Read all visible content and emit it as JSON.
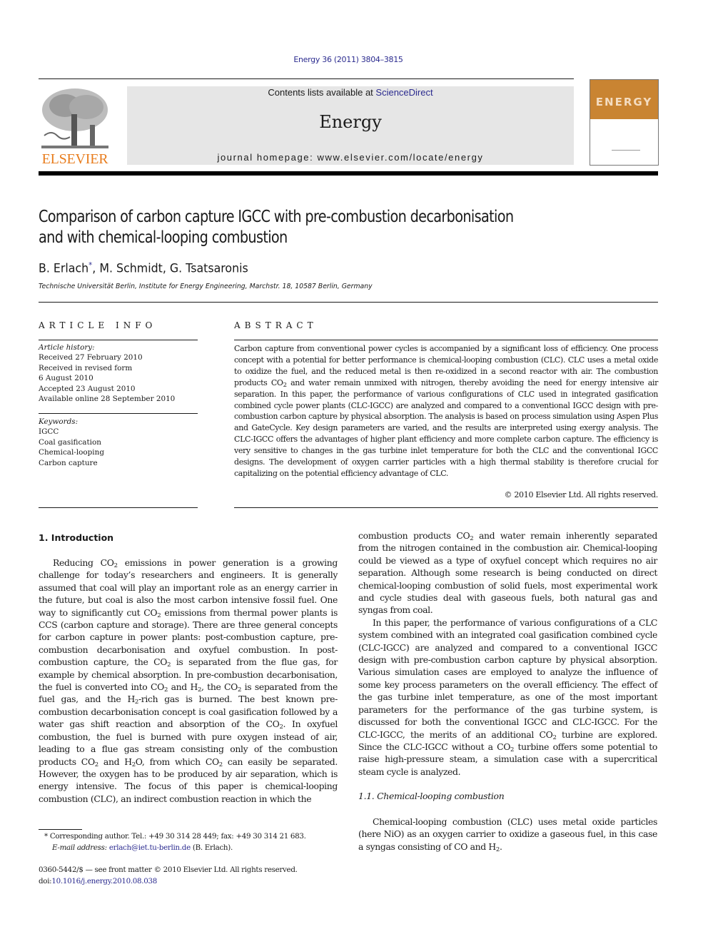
{
  "header": {
    "citation": "Energy 36 (2011) 3804–3815",
    "contents_prefix": "Contents lists available at ",
    "contents_link": "ScienceDirect",
    "journal_name": "Energy",
    "homepage": "journal homepage: www.elsevier.com/locate/energy",
    "publisher_wordmark": "ELSEVIER",
    "cover_title": "ENERGY",
    "colors": {
      "link": "#2b2b8f",
      "elsevier_orange": "#e87d1e",
      "cover_orange": "#c98432",
      "banner_gray": "#e6e6e6"
    }
  },
  "article": {
    "title_line1": "Comparison of carbon capture IGCC with pre-combustion decarbonisation",
    "title_line2": "and with chemical-looping combustion",
    "authors": [
      {
        "name": "B. Erlach",
        "mark": "*"
      },
      {
        "name": ", M. Schmidt, G. Tsatsaronis",
        "mark": ""
      }
    ],
    "affiliation": "Technische Universität Berlin, Institute for Energy Engineering, Marchstr. 18, 10587 Berlin, Germany"
  },
  "article_info": {
    "heading": "ARTICLE INFO",
    "history_label": "Article history:",
    "history": [
      "Received 27 February 2010",
      "Received in revised form",
      "6 August 2010",
      "Accepted 23 August 2010",
      "Available online 28 September 2010"
    ],
    "keywords_label": "Keywords:",
    "keywords": [
      "IGCC",
      "Coal gasification",
      "Chemical-looping",
      "Carbon capture"
    ]
  },
  "abstract": {
    "heading": "ABSTRACT",
    "segments": [
      [
        "t",
        "Carbon capture from conventional power cycles is accompanied by a significant loss of efficiency. One process concept with a potential for better performance is chemical-looping combustion (CLC). CLC uses a metal oxide to oxidize the fuel, and the reduced metal is then re-oxidized in a second reactor with air. The combustion products CO"
      ],
      [
        "s",
        "2"
      ],
      [
        "t",
        " and water remain unmixed with nitrogen, thereby avoiding the need for energy intensive air separation. In this paper, the performance of various configurations of CLC used in integrated gasification combined cycle power plants (CLC-IGCC) are analyzed and compared to a conventional IGCC design with pre-combustion carbon capture by physical absorption. The analysis is based on process simulation using Aspen Plus and GateCycle. Key design parameters are varied, and the results are interpreted using exergy analysis. The CLC-IGCC offers the advantages of higher plant efficiency and more complete carbon capture. The efficiency is very sensitive to changes in the gas turbine inlet temperature for both the CLC and the conventional IGCC designs. The development of oxygen carrier particles with a high thermal stability is therefore crucial for capitalizing on the potential efficiency advantage of CLC."
      ]
    ],
    "copyright": "© 2010 Elsevier Ltd. All rights reserved."
  },
  "body": {
    "section1_heading": "1.  Introduction",
    "left_paragraph": [
      [
        "t",
        "Reducing CO"
      ],
      [
        "s",
        "2"
      ],
      [
        "t",
        " emissions in power generation is a growing challenge for today’s researchers and engineers. It is generally assumed that coal will play an important role as an energy carrier in the future, but coal is also the most carbon intensive fossil fuel. One way to significantly cut CO"
      ],
      [
        "s",
        "2"
      ],
      [
        "t",
        " emissions from thermal power plants is CCS (carbon capture and storage). There are three general concepts for carbon capture in power plants: post-combustion capture, pre-combustion decarbonisation and oxyfuel combustion. In post-combustion capture, the CO"
      ],
      [
        "s",
        "2"
      ],
      [
        "t",
        " is separated from the flue gas, for example by chemical absorption. In pre-combustion decarbonisation, the fuel is converted into CO"
      ],
      [
        "s",
        "2"
      ],
      [
        "t",
        " and H"
      ],
      [
        "s",
        "2"
      ],
      [
        "t",
        ", the CO"
      ],
      [
        "s",
        "2"
      ],
      [
        "t",
        " is separated from the fuel gas, and the H"
      ],
      [
        "s",
        "2"
      ],
      [
        "t",
        "-rich gas is burned. The best known pre-combustion decarbonisation concept is coal gasification followed by a water gas shift reaction and absorption of the CO"
      ],
      [
        "s",
        "2"
      ],
      [
        "t",
        ". In oxyfuel combustion, the fuel is burned with pure oxygen instead of air, leading to a flue gas stream consisting only of the combustion products CO"
      ],
      [
        "s",
        "2"
      ],
      [
        "t",
        " and H"
      ],
      [
        "s",
        "2"
      ],
      [
        "t",
        "O, from which CO"
      ],
      [
        "s",
        "2"
      ],
      [
        "t",
        " can easily be separated. However, the oxygen has to be produced by air separation, which is energy intensive. The focus of this paper is chemical-looping combustion (CLC), an indirect combustion reaction in which the"
      ]
    ],
    "right_paragraph1": [
      [
        "t",
        "combustion products CO"
      ],
      [
        "s",
        "2"
      ],
      [
        "t",
        " and water remain inherently separated from the nitrogen contained in the combustion air. Chemical-looping could be viewed as a type of oxyfuel concept which requires no air separation. Although some research is being conducted on direct chemical-looping combustion of solid fuels, most experimental work and cycle studies deal with gaseous fuels, both natural gas and syngas from coal."
      ]
    ],
    "right_paragraph2": [
      [
        "t",
        "In this paper, the performance of various configurations of a CLC system combined  with an integrated coal gasification combined cycle (CLC-IGCC) are analyzed and compared to a conventional IGCC design with pre-combustion carbon capture by physical absorption. Various simulation cases are employed to analyze the influence of some key process parameters on the overall efficiency. The effect of the gas turbine inlet temperature, as one of the most important parameters for the performance of the gas turbine system, is discussed for both the conventional IGCC and CLC-IGCC. For the CLC-IGCC, the merits of an additional CO"
      ],
      [
        "s",
        "2"
      ],
      [
        "t",
        " turbine are explored. Since the CLC-IGCC without a CO"
      ],
      [
        "s",
        "2"
      ],
      [
        "t",
        " turbine offers some potential to raise high-pressure steam, a simulation case with a supercritical steam cycle is analyzed."
      ]
    ],
    "subsection_heading": "1.1.  Chemical-looping combustion",
    "right_paragraph3": [
      [
        "t",
        "Chemical-looping combustion (CLC) uses metal oxide particles (here NiO) as an oxygen carrier to oxidize a gaseous fuel, in this case a syngas consisting of CO and H"
      ],
      [
        "s",
        "2"
      ],
      [
        "t",
        "."
      ]
    ]
  },
  "footnotes": {
    "corresponding": "*  Corresponding author. Tel.: +49 30 314 28 449; fax: +49 30 314 21 683.",
    "email_label": "E-mail address:",
    "email": "erlach@iet.tu-berlin.de",
    "email_suffix": " (B. Erlach).",
    "front_matter": "0360-5442/$ — see front matter © 2010 Elsevier Ltd. All rights reserved.",
    "doi_prefix": "doi:",
    "doi": "10.1016/j.energy.2010.08.038"
  }
}
